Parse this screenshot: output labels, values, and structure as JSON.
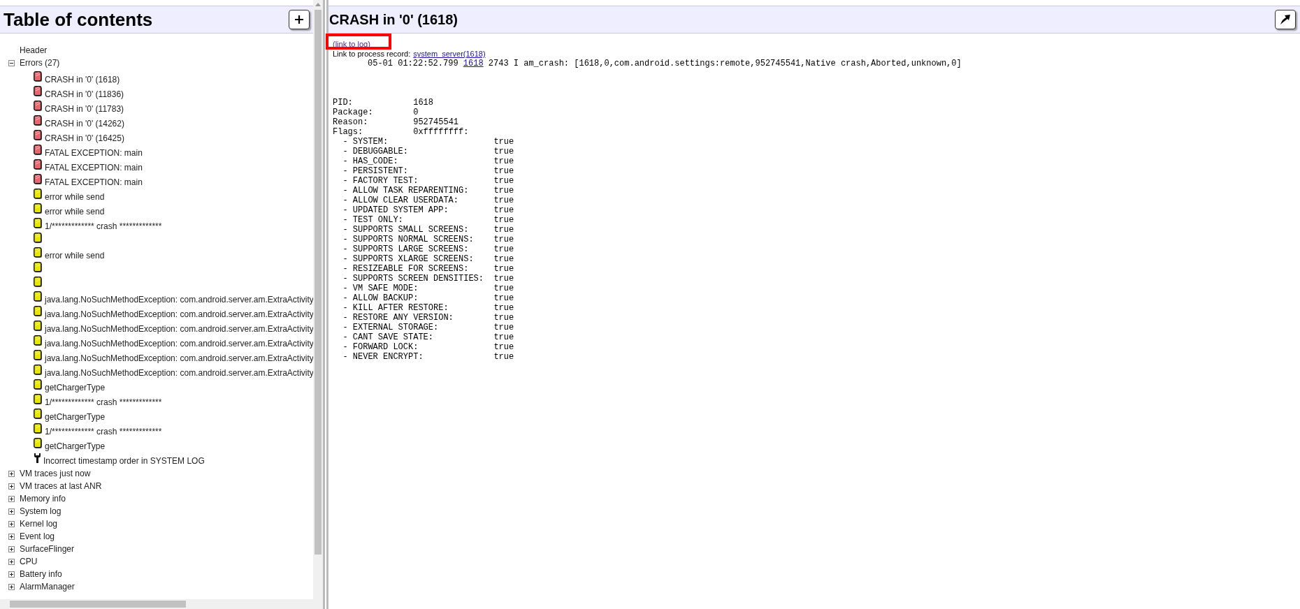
{
  "toc": {
    "title": "Table of contents",
    "items": [
      {
        "label": "Header",
        "kind": "leaf"
      },
      {
        "label": "Errors (27)",
        "kind": "section",
        "expanded": true,
        "children": [
          {
            "label": "CRASH in '0' (1618)",
            "kind": "error"
          },
          {
            "label": "CRASH in '0' (11836)",
            "kind": "error"
          },
          {
            "label": "CRASH in '0' (11783)",
            "kind": "error"
          },
          {
            "label": "CRASH in '0' (14262)",
            "kind": "error"
          },
          {
            "label": "CRASH in '0' (16425)",
            "kind": "error"
          },
          {
            "label": "FATAL EXCEPTION: main",
            "kind": "error"
          },
          {
            "label": "FATAL EXCEPTION: main",
            "kind": "error"
          },
          {
            "label": "FATAL EXCEPTION: main",
            "kind": "error"
          },
          {
            "label": "error while send",
            "kind": "warning"
          },
          {
            "label": "error while send",
            "kind": "warning"
          },
          {
            "label": "1/************* crash *************",
            "kind": "warning"
          },
          {
            "kind": "warning"
          },
          {
            "label": "error while send",
            "kind": "warning"
          },
          {
            "kind": "warning"
          },
          {
            "kind": "warning"
          },
          {
            "label": "java.lang.NoSuchMethodException: com.android.server.am.ExtraActivity",
            "kind": "warning"
          },
          {
            "label": "java.lang.NoSuchMethodException: com.android.server.am.ExtraActivity",
            "kind": "warning"
          },
          {
            "label": "java.lang.NoSuchMethodException: com.android.server.am.ExtraActivity",
            "kind": "warning"
          },
          {
            "label": "java.lang.NoSuchMethodException: com.android.server.am.ExtraActivity",
            "kind": "warning"
          },
          {
            "label": "java.lang.NoSuchMethodException: com.android.server.am.ExtraActivity",
            "kind": "warning"
          },
          {
            "label": "java.lang.NoSuchMethodException: com.android.server.am.ExtraActivity",
            "kind": "warning"
          },
          {
            "label": "getChargerType",
            "kind": "warning"
          },
          {
            "label": "1/************* crash *************",
            "kind": "warning"
          },
          {
            "label": "getChargerType",
            "kind": "warning"
          },
          {
            "label": "1/************* crash *************",
            "kind": "warning"
          },
          {
            "label": "getChargerType",
            "kind": "warning"
          },
          {
            "label": "Incorrect timestamp order in SYSTEM LOG",
            "kind": "tool"
          }
        ]
      },
      {
        "label": "VM traces just now",
        "kind": "section",
        "expanded": false
      },
      {
        "label": "VM traces at last ANR",
        "kind": "section",
        "expanded": false
      },
      {
        "label": "Memory info",
        "kind": "section",
        "expanded": false
      },
      {
        "label": "System log",
        "kind": "section",
        "expanded": false
      },
      {
        "label": "Kernel log",
        "kind": "section",
        "expanded": false
      },
      {
        "label": "Event log",
        "kind": "section",
        "expanded": false
      },
      {
        "label": "SurfaceFlinger",
        "kind": "section",
        "expanded": false
      },
      {
        "label": "CPU",
        "kind": "section",
        "expanded": false
      },
      {
        "label": "Battery info",
        "kind": "section",
        "expanded": false
      },
      {
        "label": "AlarmManager",
        "kind": "section",
        "expanded": false
      }
    ]
  },
  "detail": {
    "title": "CRASH in '0' (1618)",
    "link_to_log": "(link to log)",
    "process_record": {
      "label": "Link to process record:",
      "link": "system_server(1618)"
    },
    "log_line": {
      "timestamp": "05-01 01:22:52.799",
      "pid": "1618",
      "rest": "2743 I am_crash: [1618,0,com.android.settings:remote,952745541,Native crash,Aborted,unknown,0]"
    },
    "fields": [
      {
        "key": "PID:",
        "value": "1618"
      },
      {
        "key": "Package:",
        "value": "0"
      },
      {
        "key": "Reason:",
        "value": "952745541"
      },
      {
        "key": "Flags:",
        "value": "0xffffffff:"
      }
    ],
    "flags": [
      {
        "name": "- SYSTEM:",
        "value": "true"
      },
      {
        "name": "- DEBUGGABLE:",
        "value": "true"
      },
      {
        "name": "- HAS_CODE:",
        "value": "true"
      },
      {
        "name": "- PERSISTENT:",
        "value": "true"
      },
      {
        "name": "- FACTORY TEST:",
        "value": "true"
      },
      {
        "name": "- ALLOW TASK REPARENTING:",
        "value": "true"
      },
      {
        "name": "- ALLOW CLEAR USERDATA:",
        "value": "true"
      },
      {
        "name": "- UPDATED SYSTEM APP:",
        "value": "true"
      },
      {
        "name": "- TEST ONLY:",
        "value": "true"
      },
      {
        "name": "- SUPPORTS SMALL SCREENS:",
        "value": "true"
      },
      {
        "name": "- SUPPORTS NORMAL SCREENS:",
        "value": "true"
      },
      {
        "name": "- SUPPORTS LARGE SCREENS:",
        "value": "true"
      },
      {
        "name": "- SUPPORTS XLARGE SCREENS:",
        "value": "true"
      },
      {
        "name": "- RESIZEABLE FOR SCREENS:",
        "value": "true"
      },
      {
        "name": "- SUPPORTS SCREEN DENSITIES:",
        "value": "true"
      },
      {
        "name": "- VM SAFE MODE:",
        "value": "true"
      },
      {
        "name": "- ALLOW BACKUP:",
        "value": "true"
      },
      {
        "name": "- KILL AFTER RESTORE:",
        "value": "true"
      },
      {
        "name": "- RESTORE ANY VERSION:",
        "value": "true"
      },
      {
        "name": "- EXTERNAL STORAGE:",
        "value": "true"
      },
      {
        "name": "- CANT SAVE STATE:",
        "value": "true"
      },
      {
        "name": "- FORWARD LOCK:",
        "value": "true"
      },
      {
        "name": "- NEVER ENCRYPT:",
        "value": "true"
      }
    ]
  }
}
